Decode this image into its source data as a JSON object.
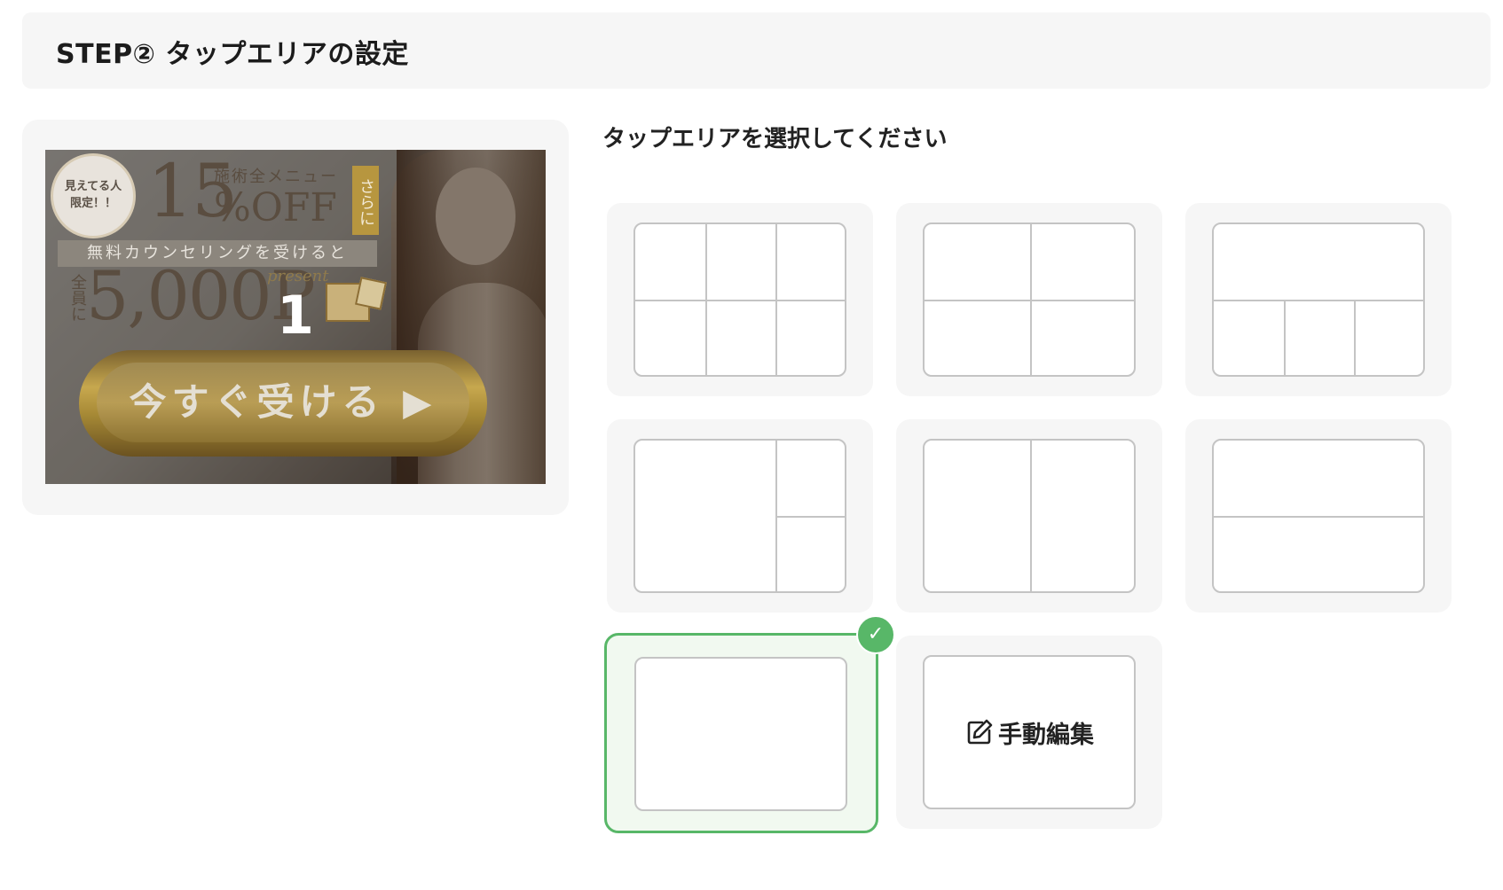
{
  "header": {
    "title": "STEP② タップエリアの設定"
  },
  "preview": {
    "area_number": "1",
    "banner": {
      "badge": "見えてる人\n限定！！",
      "discount": "15",
      "discount_suffix": "%OFF",
      "menu": "施術全メニュー",
      "sarani": "さらに",
      "stripe": "無料カウンセリングを受けると",
      "zenin": "全員に",
      "amount": "5,000P",
      "present": "present",
      "cta": "今すぐ受ける ▶"
    }
  },
  "selection": {
    "title": "タップエリアを選択してください",
    "layouts": [
      {
        "name": "layout-3x2"
      },
      {
        "name": "layout-2x2"
      },
      {
        "name": "layout-1-top-3-bottom"
      },
      {
        "name": "layout-large-left-2-right"
      },
      {
        "name": "layout-2-columns"
      },
      {
        "name": "layout-2-rows"
      },
      {
        "name": "layout-single",
        "selected": true
      },
      {
        "name": "layout-manual",
        "label": "手動編集"
      }
    ],
    "selected_check": "✓"
  },
  "colors": {
    "accent": "#58b768",
    "card_bg": "#f6f6f6",
    "line": "#c4c4c4"
  }
}
